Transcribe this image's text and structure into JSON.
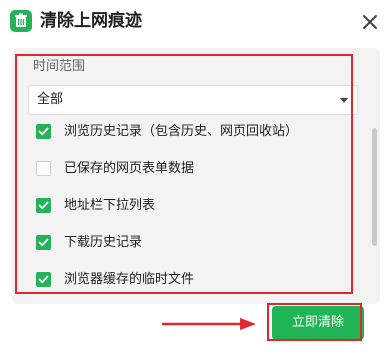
{
  "dialog": {
    "title": "清除上网痕迹",
    "app_icon": "trash-icon",
    "close_icon": "close-icon"
  },
  "section": {
    "label": "时间范围"
  },
  "time_range": {
    "selected": "全部"
  },
  "options": [
    {
      "label": "浏览历史记录（包含历史、网页回收站）",
      "checked": true
    },
    {
      "label": "已保存的网页表单数据",
      "checked": false
    },
    {
      "label": "地址栏下拉列表",
      "checked": true
    },
    {
      "label": "下载历史记录",
      "checked": true
    },
    {
      "label": "浏览器缓存的临时文件",
      "checked": true
    }
  ],
  "actions": {
    "clear_now": "立即清除"
  },
  "colors": {
    "accent": "#1fb456",
    "annotation": "#e1262d"
  }
}
